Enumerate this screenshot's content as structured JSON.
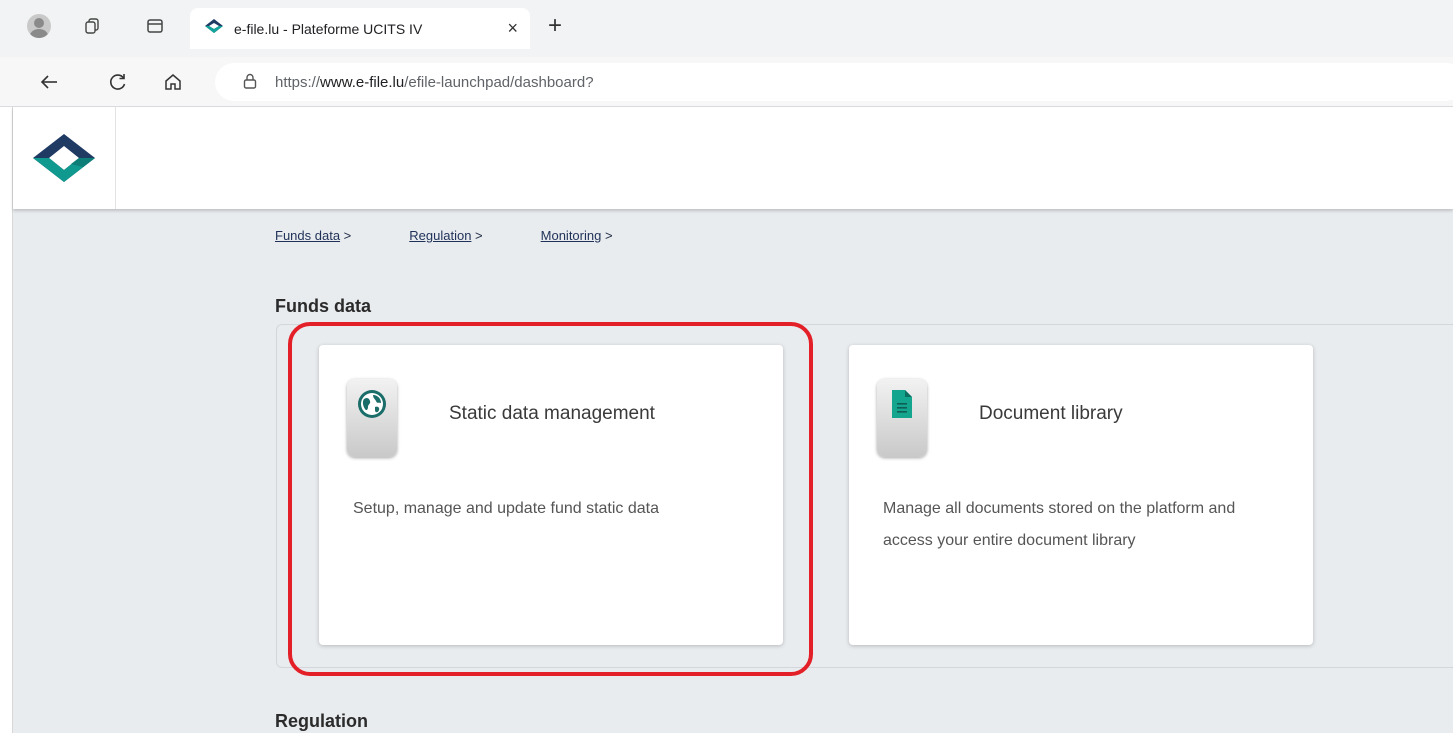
{
  "browser": {
    "tab_title": "e-file.lu - Plateforme UCITS IV",
    "tab_close": "×",
    "new_tab": "+",
    "url_prefix": "https://",
    "url_domain": "www.e-file.lu",
    "url_path": "/efile-launchpad/dashboard?"
  },
  "breadcrumbs": [
    {
      "label": "Funds data",
      "sep": " >"
    },
    {
      "label": "Regulation",
      "sep": " >"
    },
    {
      "label": "Monitoring",
      "sep": " >"
    }
  ],
  "sections": {
    "funds_data": "Funds data",
    "regulation": "Regulation"
  },
  "cards": [
    {
      "title": "Static data management",
      "description": "Setup, manage and update fund static data",
      "icon": "globe-icon"
    },
    {
      "title": "Document library",
      "description": "Manage all documents stored on the platform and access your entire document library",
      "icon": "document-icon"
    }
  ],
  "colors": {
    "brand_teal": "#0f8f8a",
    "brand_navy": "#1f3a63",
    "highlight": "#e32027"
  }
}
